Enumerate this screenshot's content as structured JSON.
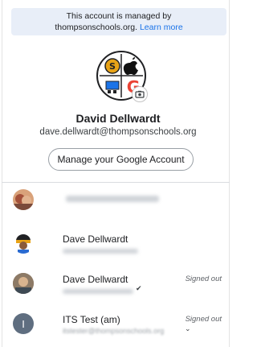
{
  "managed_notice": {
    "line1": "This account is managed by",
    "domain": "thompsonschools.org.",
    "learn_more": "Learn more"
  },
  "profile": {
    "name": "David Dellwardt",
    "email": "dave.dellwardt@thompsonschools.org",
    "manage_button": "Manage your Google Account"
  },
  "accounts": [
    {
      "name": "",
      "email": "",
      "status": ""
    },
    {
      "name": "Dave Dellwardt",
      "email": "",
      "status": ""
    },
    {
      "name": "Dave Dellwardt",
      "email": "",
      "status": "Signed out"
    },
    {
      "name": "ITS Test (am)",
      "email": "itstester@thompsonschools.org",
      "status": "Signed out",
      "initial": "I",
      "avatar_color": "#5f6e80"
    }
  ],
  "colors": {
    "accent": "#1a73e8",
    "banner_bg": "#e8eef8"
  }
}
